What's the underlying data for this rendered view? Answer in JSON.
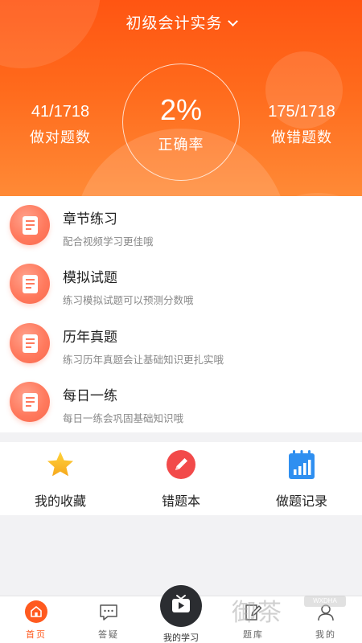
{
  "header": {
    "course_title": "初级会计实务",
    "correct_rate": "2%",
    "correct_rate_label": "正确率",
    "correct_count": "41/1718",
    "correct_label": "做对题数",
    "wrong_count": "175/1718",
    "wrong_label": "做错题数"
  },
  "practice_list": {
    "items": [
      {
        "title": "章节练习",
        "subtitle": "配合视频学习更佳哦"
      },
      {
        "title": "模拟试题",
        "subtitle": "练习模拟试题可以预测分数哦"
      },
      {
        "title": "历年真题",
        "subtitle": "练习历年真题会让基础知识更扎实哦"
      },
      {
        "title": "每日一练",
        "subtitle": "每日一练会巩固基础知识哦"
      }
    ]
  },
  "tools": {
    "items": [
      {
        "label": "我的收藏",
        "icon": "star-icon"
      },
      {
        "label": "错题本",
        "icon": "pencil-icon"
      },
      {
        "label": "做题记录",
        "icon": "record-chart-icon"
      }
    ]
  },
  "tabbar": {
    "tabs": [
      {
        "label": "首页",
        "icon": "home-icon",
        "active": true
      },
      {
        "label": "答疑",
        "icon": "chat-icon"
      },
      {
        "label": "我的学习",
        "icon": "play-tv-icon"
      },
      {
        "label": "题库",
        "icon": "edit-icon"
      },
      {
        "label": "我的",
        "icon": "user-icon"
      }
    ]
  },
  "watermark": {
    "text": "御茶",
    "badge": "WXDHA"
  },
  "colors": {
    "accent": "#ff5a1f",
    "header_top": "#ff5512",
    "header_bottom": "#ff8a36",
    "item_icon": "#ff7a5e"
  }
}
